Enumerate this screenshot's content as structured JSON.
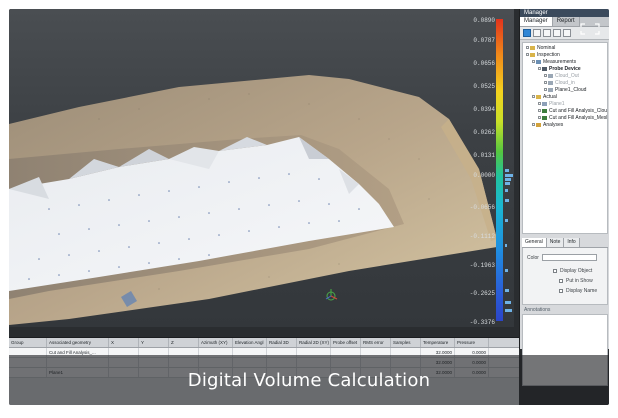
{
  "colors": {
    "accent": "#2f86d6",
    "caption_bg": "#1e2024",
    "viewport_bg": "#3c4044"
  },
  "scale": {
    "labels": [
      "0.0890",
      "0.0787",
      "0.0656",
      "0.0525",
      "0.0394",
      "0.0262",
      "0.0131",
      "0.0000",
      "-0.0656",
      "-0.1112",
      "-0.1963",
      "-0.2625",
      "-0.3376"
    ]
  },
  "manager": {
    "title": "Manager",
    "tabs": [
      "Manager",
      "Report"
    ],
    "tree": [
      {
        "label": "Nominal",
        "indent": 0,
        "icon": "folder-icon"
      },
      {
        "label": "Inspection",
        "indent": 0,
        "icon": "folder-icon"
      },
      {
        "label": "Measurements",
        "indent": 1,
        "icon": "measure-icon"
      },
      {
        "label": "Probe Device",
        "indent": 2,
        "icon": "device-icon",
        "bold": true
      },
      {
        "label": "Cloud_Out",
        "indent": 3,
        "icon": "cloud-icon",
        "faded": true
      },
      {
        "label": "Cloud_in",
        "indent": 3,
        "icon": "cloud-icon",
        "faded": true
      },
      {
        "label": "Plane1_Cloud",
        "indent": 3,
        "icon": "cloud-icon"
      },
      {
        "label": "Actual",
        "indent": 1,
        "icon": "folder-icon"
      },
      {
        "label": "Plane1",
        "indent": 2,
        "icon": "plane-icon",
        "faded": true
      },
      {
        "label": "Cut and Fill Analysis_Cloud",
        "indent": 2,
        "icon": "analysis-icon"
      },
      {
        "label": "Cut and Fill Analysis_Mesh",
        "indent": 2,
        "icon": "analysis-icon"
      },
      {
        "label": "Analyses",
        "indent": 1,
        "icon": "chart-icon"
      }
    ],
    "prop_tabs": [
      "General",
      "Note",
      "Info"
    ],
    "color_label": "Color",
    "display_object": "Display Object",
    "put_in_show": "Put in Show",
    "display_name": "Display Name",
    "annotations_label": "Annotations"
  },
  "table": {
    "columns": [
      "Group",
      "Associated geometry",
      "X",
      "Y",
      "Z",
      "Azimuth (XY)",
      "Elevation Angl",
      "Radial 3D",
      "Radial 2D (XY)",
      "Probe offset",
      "RMS error",
      "Samples",
      "Temperature",
      "Pressure"
    ],
    "rows": [
      [
        "",
        "Cut and Fill Analysis_...",
        "",
        "",
        "",
        "",
        "",
        "",
        "",
        "",
        "",
        "",
        "32.0000",
        "0.0000"
      ],
      [
        "",
        "",
        "",
        "",
        "",
        "",
        "",
        "",
        "",
        "",
        "",
        "",
        "32.0000",
        "0.0000"
      ],
      [
        "",
        "Plane1",
        "",
        "",
        "",
        "",
        "",
        "",
        "",
        "",
        "",
        "",
        "32.0000",
        "0.0000"
      ]
    ]
  },
  "caption": {
    "title": "Digital Volume Calculation"
  }
}
